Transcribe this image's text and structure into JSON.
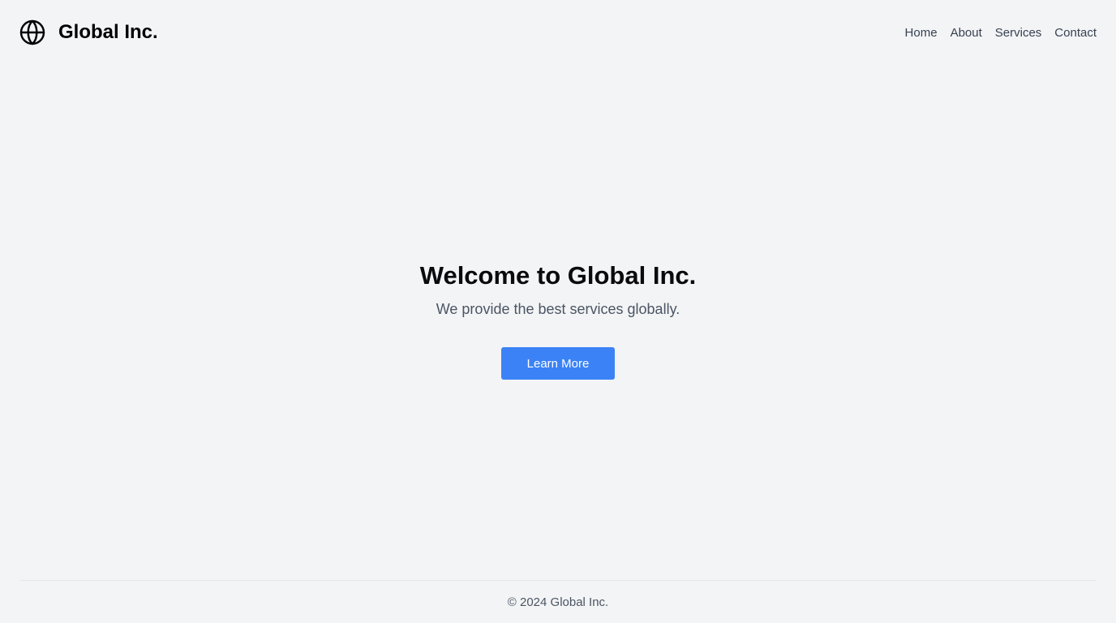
{
  "header": {
    "logo_icon": "globe-icon",
    "brand_name": "Global Inc.",
    "nav": [
      {
        "label": "Home"
      },
      {
        "label": "About"
      },
      {
        "label": "Services"
      },
      {
        "label": "Contact"
      }
    ]
  },
  "hero": {
    "title": "Welcome to Global Inc.",
    "subtitle": "We provide the best services globally.",
    "button_label": "Learn More"
  },
  "footer": {
    "copyright": "© 2024 Global Inc."
  },
  "colors": {
    "background": "#f3f4f6",
    "accent": "#3b82f6",
    "text_primary": "#0b0b0f",
    "text_secondary": "#4b5563"
  }
}
